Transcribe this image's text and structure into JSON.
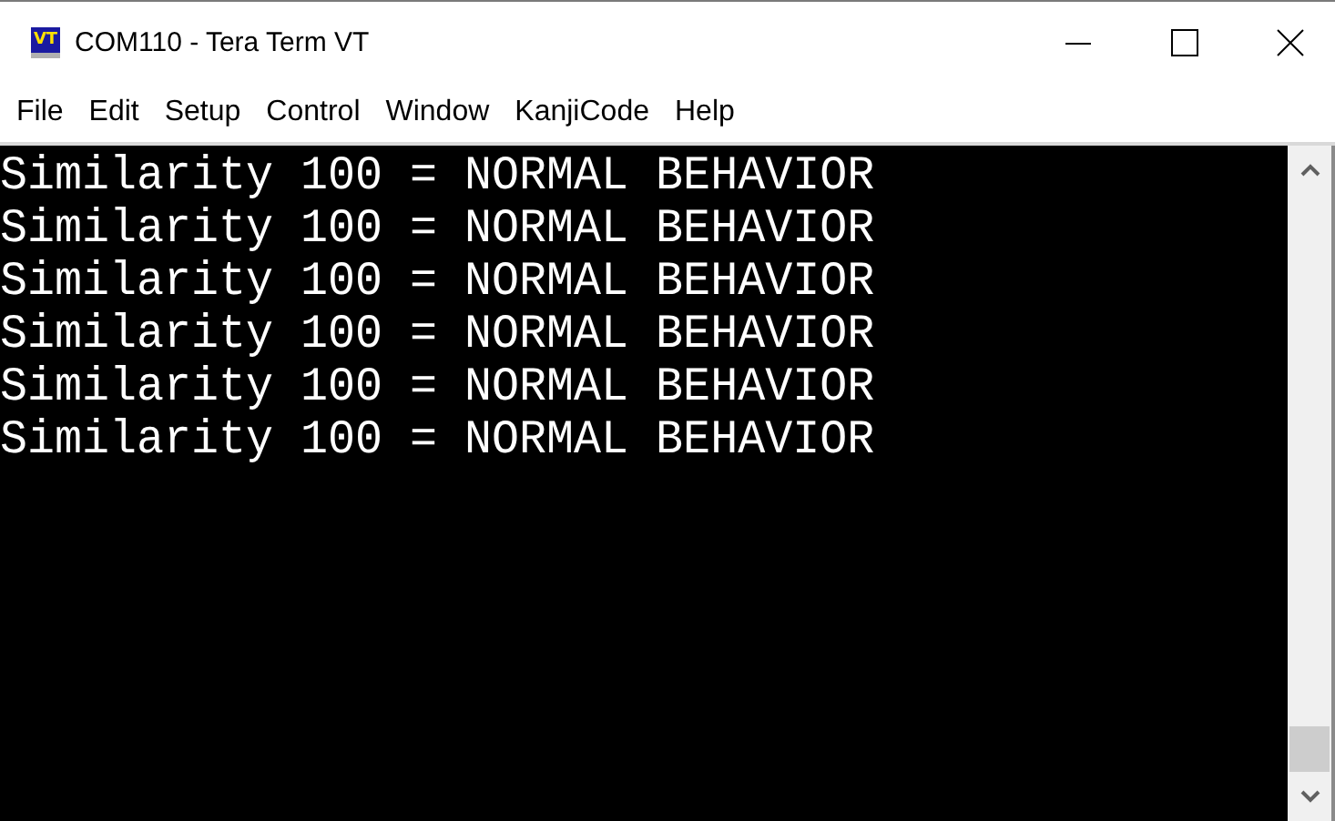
{
  "window": {
    "title": "COM110 - Tera Term VT",
    "icon_text": "VT"
  },
  "menu": [
    "File",
    "Edit",
    "Setup",
    "Control",
    "Window",
    "KanjiCode",
    "Help"
  ],
  "terminal": {
    "lines": [
      "Similarity 100 = NORMAL BEHAVIOR",
      "Similarity 100 = NORMAL BEHAVIOR",
      "Similarity 100 = NORMAL BEHAVIOR",
      "Similarity 100 = NORMAL BEHAVIOR",
      "Similarity 100 = NORMAL BEHAVIOR",
      "Similarity 100 = NORMAL BEHAVIOR"
    ]
  }
}
